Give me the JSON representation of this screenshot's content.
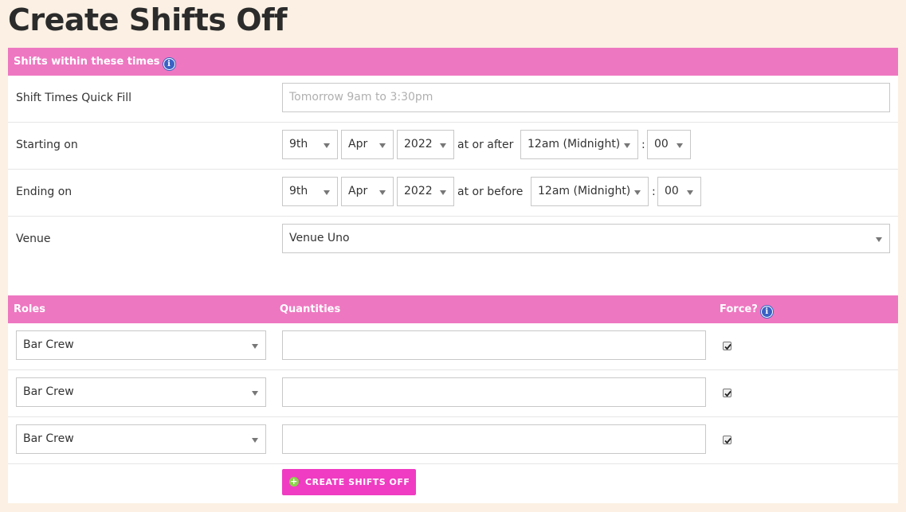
{
  "page": {
    "title": "Create Shifts Off"
  },
  "times_section": {
    "header": "Shifts within these times",
    "quick_fill": {
      "label": "Shift Times Quick Fill",
      "placeholder": "Tomorrow 9am to 3:30pm"
    },
    "starting": {
      "label": "Starting on",
      "day": "9th",
      "month": "Apr",
      "year": "2022",
      "connector": "at or after",
      "hour": "12am (Midnight)",
      "colon": ":",
      "minute": "00"
    },
    "ending": {
      "label": "Ending on",
      "day": "9th",
      "month": "Apr",
      "year": "2022",
      "connector": "at or before",
      "hour": "12am (Midnight)",
      "colon": ":",
      "minute": "00"
    },
    "venue": {
      "label": "Venue",
      "value": "Venue Uno"
    }
  },
  "roles_section": {
    "headers": {
      "roles": "Roles",
      "quantities": "Quantities",
      "force": "Force?"
    },
    "rows": [
      {
        "role": "Bar Crew",
        "quantity": "",
        "force": true
      },
      {
        "role": "Bar Crew",
        "quantity": "",
        "force": true
      },
      {
        "role": "Bar Crew",
        "quantity": "",
        "force": true
      }
    ]
  },
  "actions": {
    "create_label": "CREATE SHIFTS OFF"
  },
  "icons": {
    "info": "info-icon",
    "add": "plus-circle-icon",
    "dropdown": "chevron-down-icon",
    "check": "checkmark-icon"
  },
  "colors": {
    "header_pink": "#ee77c1",
    "button_pink": "#ef3cc2",
    "background": "#fbf0e3",
    "info_blue": "#3a62c4"
  }
}
